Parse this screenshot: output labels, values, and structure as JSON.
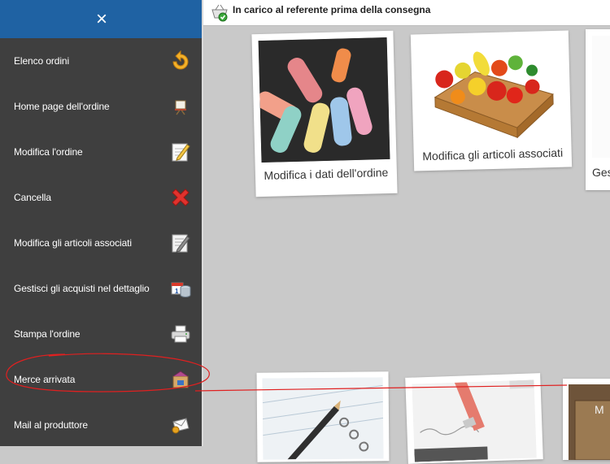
{
  "sidebar": {
    "close_icon": "×",
    "items": [
      {
        "label": "Elenco ordini",
        "icon": "return-arrow-icon"
      },
      {
        "label": "Home page dell'ordine",
        "icon": "easel-icon"
      },
      {
        "label": "Modifica l'ordine",
        "icon": "pencil-paper-icon"
      },
      {
        "label": "Cancella",
        "icon": "red-x-icon"
      },
      {
        "label": "Modifica gli articoli associati",
        "icon": "edit-list-icon"
      },
      {
        "label": "Gestisci gli acquisti nel dettaglio",
        "icon": "calendar-db-icon"
      },
      {
        "label": "Stampa l'ordine",
        "icon": "printer-icon"
      },
      {
        "label": "Merce arrivata",
        "icon": "delivery-box-icon"
      },
      {
        "label": "Mail al produttore",
        "icon": "mail-icon"
      }
    ]
  },
  "topbar": {
    "status_text": "In carico al referente prima della consegna",
    "status_icon": "basket-check-icon"
  },
  "cards": [
    {
      "caption": "Modifica i dati dell'ordine",
      "image": "chalk-photo"
    },
    {
      "caption": "Modifica gli articoli associati",
      "image": "fruit-crate-photo"
    },
    {
      "caption": "Ges",
      "image": "partial-photo"
    },
    {
      "caption": "",
      "image": "notebook-pencil-photo"
    },
    {
      "caption": "",
      "image": "pencil-eraser-photo"
    },
    {
      "caption": "",
      "image": "partial-box-photo"
    }
  ],
  "colors": {
    "sidebar_bg": "#3f3f3f",
    "header_bg": "#1f62a3",
    "canvas_bg": "#c9c9c9",
    "annotation_red": "#e02020"
  }
}
